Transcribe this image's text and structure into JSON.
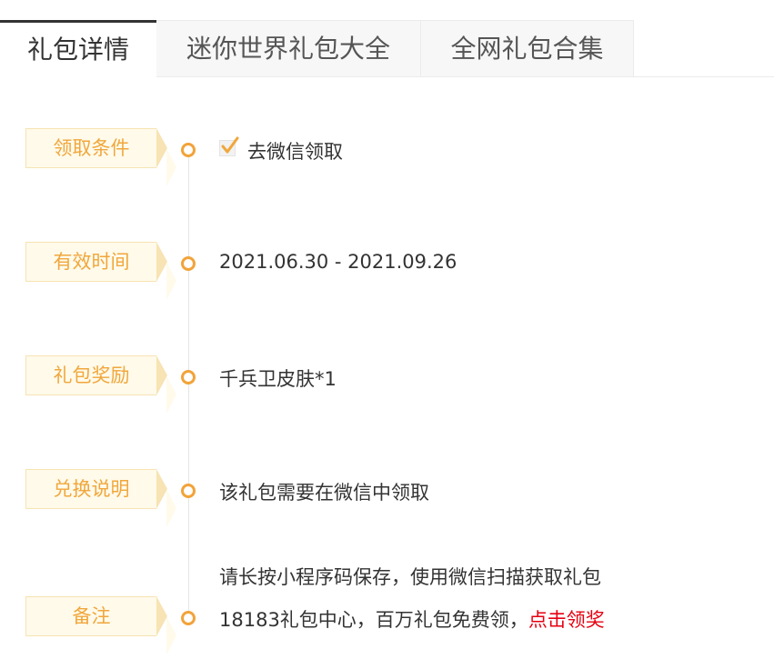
{
  "tabs": [
    {
      "label": "礼包详情",
      "active": true
    },
    {
      "label": "迷你世界礼包大全",
      "active": false
    },
    {
      "label": "全网礼包合集",
      "active": false
    }
  ],
  "rows": {
    "condition": {
      "label": "领取条件",
      "value": "去微信领取",
      "checked": true
    },
    "validity": {
      "label": "有效时间",
      "value": "2021.06.30 - 2021.09.26"
    },
    "reward": {
      "label": "礼包奖励",
      "value": "千兵卫皮肤*1"
    },
    "redeem": {
      "label": "兑换说明",
      "value": "该礼包需要在微信中领取"
    },
    "note": {
      "label": "备注",
      "line1": "请长按小程序码保存，使用微信扫描获取礼包",
      "line2": "18183礼包中心，百万礼包免费领，",
      "link": "点击领奖"
    }
  },
  "colors": {
    "accent": "#f0a73c",
    "label_bg": "#fffaea",
    "link": "#e60012"
  }
}
